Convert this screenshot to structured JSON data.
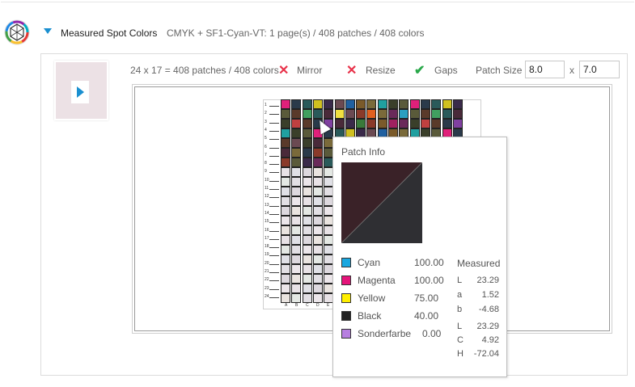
{
  "section": {
    "title": "Measured Spot Colors",
    "description": "CMYK + SF1-Cyan-VT: 1 page(s) / 408 patches / 408 colors"
  },
  "toolbar": {
    "summary": "24 x 17 = 408 patches / 408 colors",
    "mirror_label": "Mirror",
    "resize_label": "Resize",
    "gaps_label": "Gaps",
    "patch_size_label": "Patch Size",
    "patch_width": "8.0",
    "times": "x",
    "patch_height": "7.0"
  },
  "chart": {
    "row_labels": [
      "1",
      "2",
      "3",
      "4",
      "5",
      "6",
      "7",
      "8",
      "9",
      "10",
      "11",
      "12",
      "13",
      "14",
      "15",
      "16",
      "17",
      "18",
      "19",
      "20",
      "21",
      "22",
      "23",
      "24"
    ],
    "col_labels": [
      "A",
      "B",
      "C",
      "D",
      "E"
    ]
  },
  "patch_info": {
    "title": "Patch Info",
    "swatch_color_top": "#3a2228",
    "swatch_color_bottom": "#2f2f33",
    "inks": [
      {
        "name": "Cyan",
        "value": "100.00",
        "color": "#1aa7e0"
      },
      {
        "name": "Magenta",
        "value": "100.00",
        "color": "#e5147a"
      },
      {
        "name": "Yellow",
        "value": "75.00",
        "color": "#ffef00"
      },
      {
        "name": "Black",
        "value": "40.00",
        "color": "#222222"
      },
      {
        "name": "Sonderfarbe",
        "value": "0.00",
        "color": "#b77fe0"
      }
    ],
    "measured_title": "Measured",
    "lab": [
      {
        "label": "L",
        "value": "23.29"
      },
      {
        "label": "a",
        "value": "1.52"
      },
      {
        "label": "b",
        "value": "-4.68"
      }
    ],
    "lch": [
      {
        "label": "L",
        "value": "23.29"
      },
      {
        "label": "C",
        "value": "4.92"
      },
      {
        "label": "H",
        "value": "-72.04"
      }
    ]
  },
  "colors": {
    "accent": "#1a8fd0",
    "error_x": "#e8324a",
    "check": "#2aa84a"
  }
}
